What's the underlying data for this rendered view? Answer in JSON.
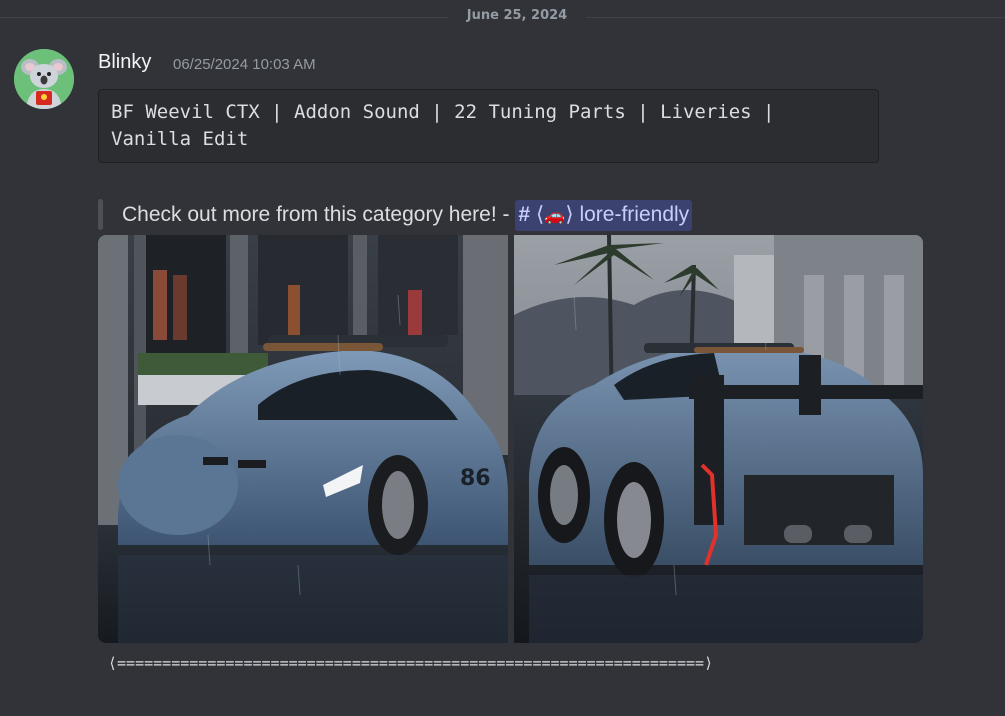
{
  "divider": {
    "date": "June 25, 2024"
  },
  "message": {
    "author": "Blinky",
    "timestamp": "06/25/2024 10:03 AM",
    "code": "BF Weevil CTX | Addon Sound | 22 Tuning Parts | Liveries |\nVanilla Edit",
    "quote": {
      "text": "Check out more from this category here! -",
      "channel_hash": "#",
      "channel_bracket_open": "⟨",
      "channel_emoji": "🚗",
      "channel_bracket_close": "⟩",
      "channel_name": "lore-friendly"
    },
    "images": [
      {
        "alt": "car-front-view"
      },
      {
        "alt": "car-rear-view"
      }
    ],
    "separator": "⟨=================================================================⟩"
  },
  "colors": {
    "background": "#313338",
    "code_bg": "#2b2d31",
    "mention_bg": "#3c4270",
    "mention_text": "#c9cdfb",
    "muted": "#949ba4"
  }
}
